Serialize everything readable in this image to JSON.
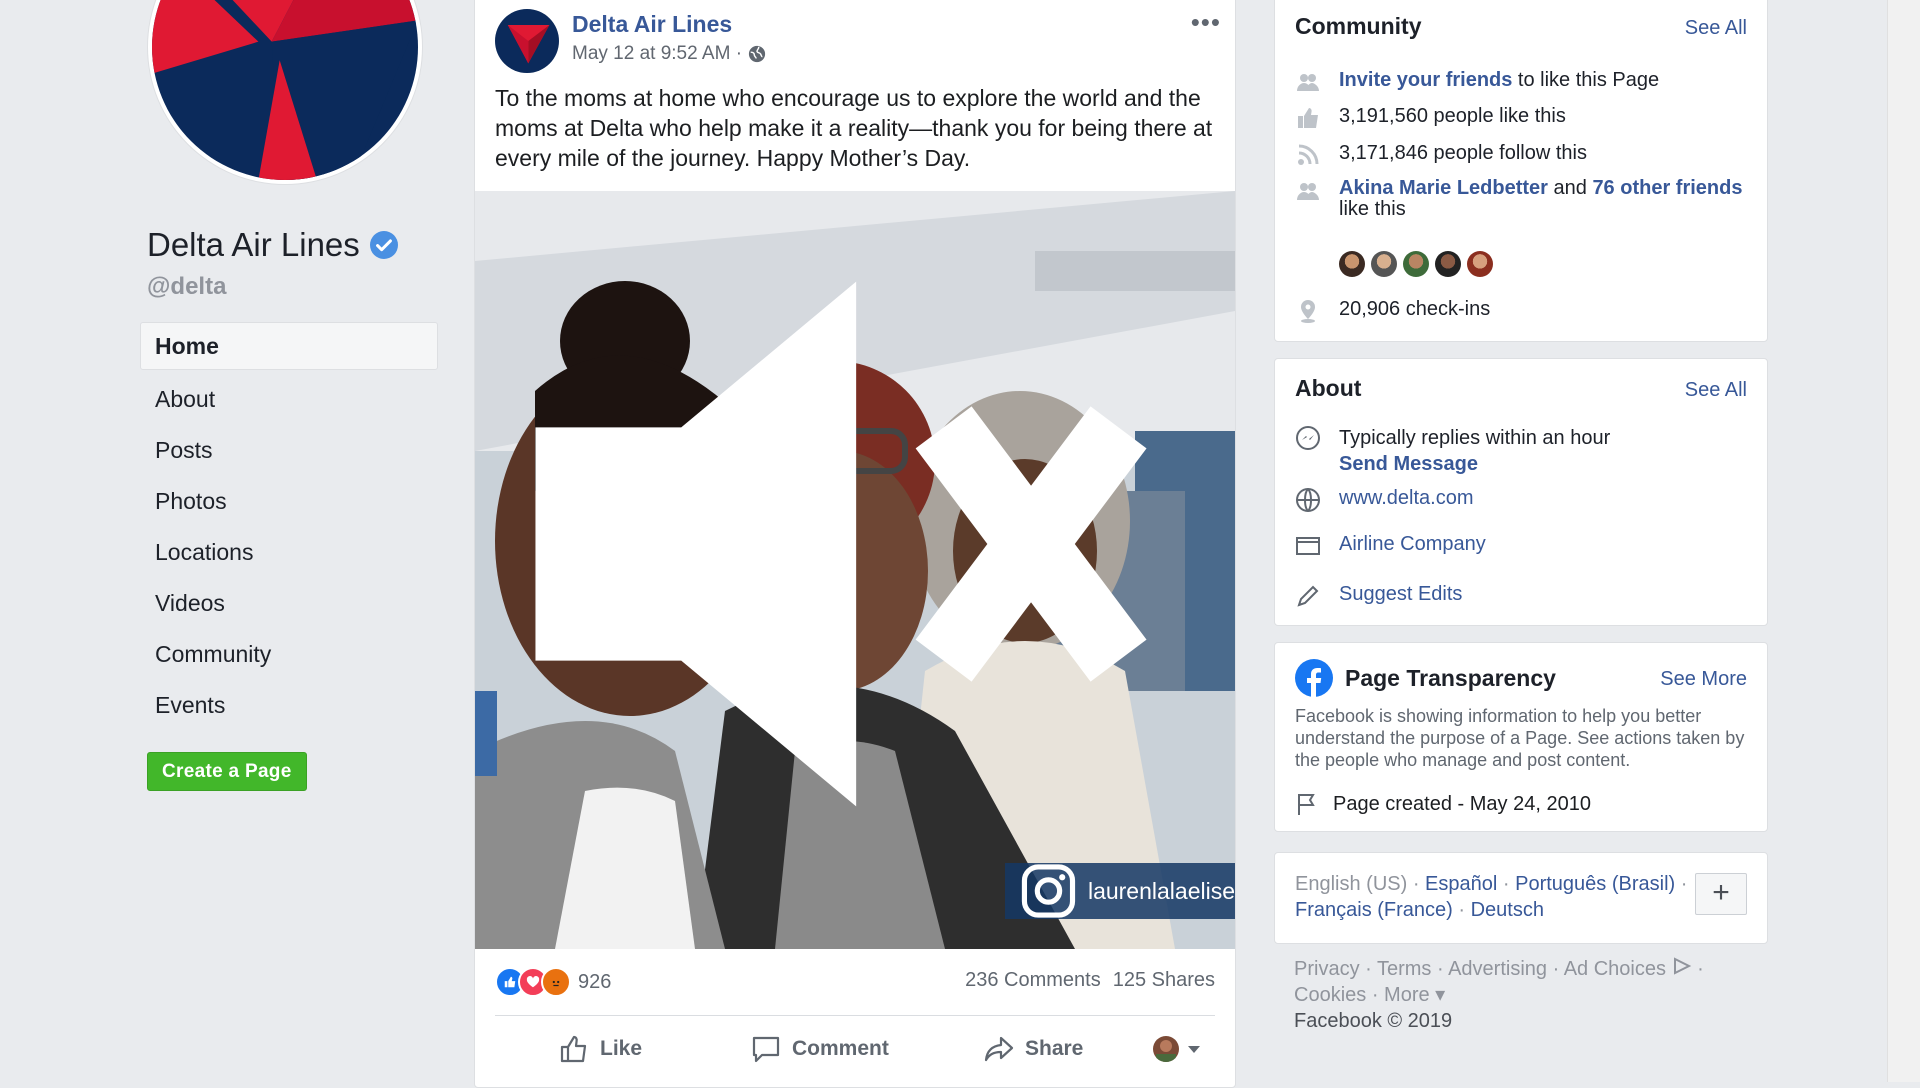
{
  "left": {
    "page_name": "Delta Air Lines",
    "handle": "@delta",
    "nav": [
      "Home",
      "About",
      "Posts",
      "Photos",
      "Locations",
      "Videos",
      "Community",
      "Events"
    ],
    "create_page": "Create a Page"
  },
  "post": {
    "author": "Delta Air Lines",
    "timestamp": "May 12 at 9:52 AM ·",
    "text": "To the moms at home who encourage us to explore the world and the moms at Delta who help make it a reality—thank you for being there at every mile of the journey. Happy Mother’s Day.",
    "ig_handle": "laurenlalaelise",
    "reaction_count": "926",
    "comments": "236 Comments",
    "shares": "125 Shares",
    "actions": {
      "like": "Like",
      "comment": "Comment",
      "share": "Share"
    }
  },
  "community": {
    "title": "Community",
    "see_all": "See All",
    "invite_link": "Invite your friends",
    "invite_rest": " to like this Page",
    "likes": "3,191,560 people like this",
    "follows": "3,171,846 people follow this",
    "friend_name": "Akina Marie Ledbetter",
    "friends_and": " and ",
    "friends_other": "76 other friends",
    "friends_rest": "like this",
    "checkins": "20,906 check-ins"
  },
  "about": {
    "title": "About",
    "see_all": "See All",
    "replies": "Typically replies within an hour",
    "send_message": "Send Message",
    "website": "www.delta.com",
    "category": "Airline Company",
    "suggest": "Suggest Edits"
  },
  "transparency": {
    "title": "Page Transparency",
    "see_more": "See More",
    "desc": "Facebook is showing information to help you better understand the purpose of a Page. See actions taken by the people who manage and post content.",
    "created": "Page created - May 24, 2010"
  },
  "languages": {
    "current": "English (US)",
    "l1": "Español",
    "l2": "Português (Brasil)",
    "l3": "Français (France)",
    "l4": "Deutsch",
    "add": "+"
  },
  "footer": {
    "line1": "Privacy · Terms · Advertising · Ad Choices",
    "line2": "Cookies · More ▾",
    "copyright": "Facebook © 2019"
  },
  "colors": {
    "link": "#385898",
    "background": "#e9ebee",
    "create_button": "#42b72a",
    "delta_red": "#e01933",
    "delta_navy": "#0b2a5b"
  }
}
